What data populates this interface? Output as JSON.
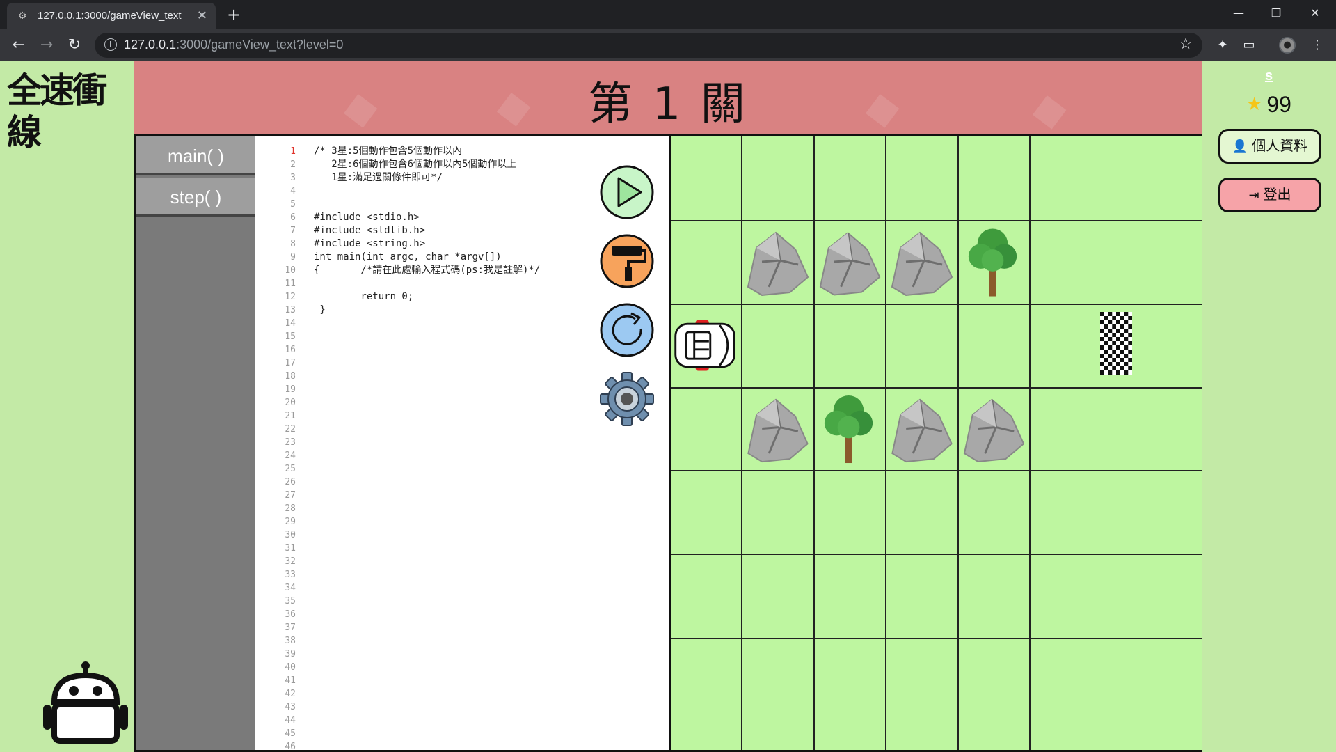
{
  "browser": {
    "tab_title": "127.0.0.1:3000/gameView_text",
    "url_host": "127.0.0.1",
    "url_rest": ":3000/gameView_text?level=0",
    "new_tab": "+",
    "close": "✕"
  },
  "header": {
    "logo_text": "全速衝線",
    "level_title": "第 1 關"
  },
  "functions": [
    {
      "label": "main( )"
    },
    {
      "label": "step( )"
    }
  ],
  "editor": {
    "active_line": 1,
    "line_count": 46,
    "code": "/* 3星:5個動作包含5個動作以內\n   2星:6個動作包含6個動作以內5個動作以上\n   1星:滿足過關條件即可*/\n\n\n#include <stdio.h>\n#include <stdlib.h>\n#include <string.h>\nint main(int argc, char *argv[])\n{       /*請在此處輸入程式碼(ps:我是註解)*/\n\n        return 0;\n }"
  },
  "controls": [
    {
      "name": "run-button",
      "icon": "play-icon",
      "color": "#c8f5c8"
    },
    {
      "name": "clear-button",
      "icon": "paint-roller-icon",
      "color": "#f7a35c"
    },
    {
      "name": "reset-button",
      "icon": "refresh-icon",
      "color": "#9cc9f2"
    },
    {
      "name": "settings-button",
      "icon": "gear-icon",
      "color": "#6f8fae"
    }
  ],
  "board": {
    "cols": 6,
    "rows": 6,
    "cells": [
      {
        "row": 2,
        "col": 2,
        "type": "rock"
      },
      {
        "row": 2,
        "col": 3,
        "type": "rock"
      },
      {
        "row": 2,
        "col": 4,
        "type": "rock"
      },
      {
        "row": 2,
        "col": 5,
        "type": "tree"
      },
      {
        "row": 3,
        "col": 1,
        "type": "car"
      },
      {
        "row": 3,
        "col": 6,
        "type": "finish-flag"
      },
      {
        "row": 4,
        "col": 2,
        "type": "rock"
      },
      {
        "row": 4,
        "col": 3,
        "type": "tree"
      },
      {
        "row": 4,
        "col": 4,
        "type": "rock"
      },
      {
        "row": 4,
        "col": 5,
        "type": "rock"
      }
    ]
  },
  "user": {
    "name": "s",
    "stars": "99",
    "profile_label": "個人資料",
    "logout_label": "登出"
  },
  "colors": {
    "background": "#c3eaa6",
    "banner": "#d98282",
    "board": "#bef6a0",
    "panel": "#7a7a7a"
  }
}
